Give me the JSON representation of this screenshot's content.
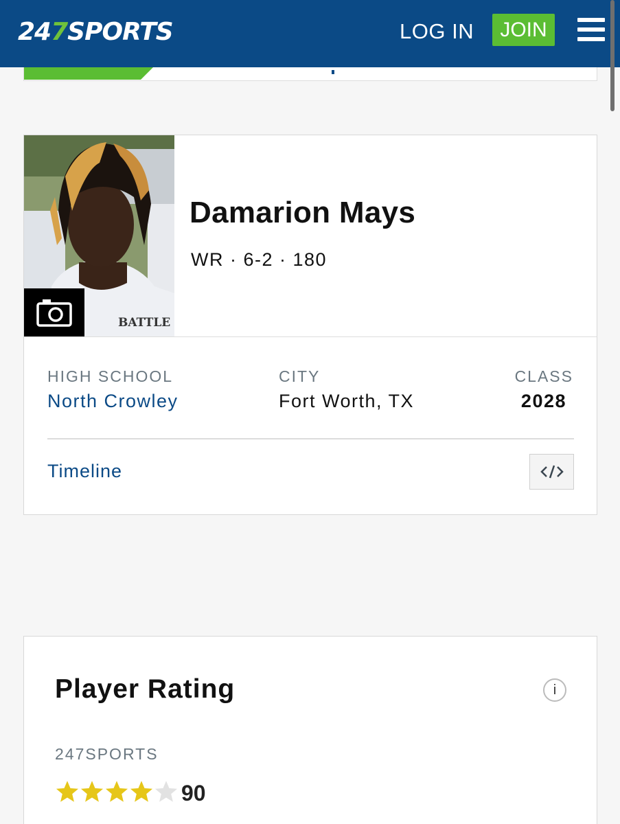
{
  "header": {
    "logo_prefix": "24",
    "logo_seven": "7",
    "logo_suffix": "SPORTS",
    "login_label": "LOG IN",
    "join_label": "JOIN",
    "menu_icon": "hamburger-menu-icon"
  },
  "player": {
    "name": "Damarion Mays",
    "meta": "WR · 6-2 · 180",
    "photo_icon": "camera-icon",
    "jersey_text": "BATTLE",
    "high_school_label": "HIGH SCHOOL",
    "high_school": "North Crowley",
    "city_label": "CITY",
    "city": "Fort Worth, TX",
    "class_label": "CLASS",
    "class": "2028",
    "timeline_label": "Timeline",
    "embed_icon": "code-embed-icon"
  },
  "rating": {
    "title": "Player Rating",
    "info_label": "i",
    "source_label": "247SPORTS",
    "stars_filled": 4,
    "stars_total": 5,
    "score": "90"
  },
  "colors": {
    "header_bg": "#0b4a86",
    "accent_green": "#5bbd33",
    "link_blue": "#0b4a86",
    "star_gold": "#e6c619",
    "star_empty": "#e2e2e2"
  }
}
